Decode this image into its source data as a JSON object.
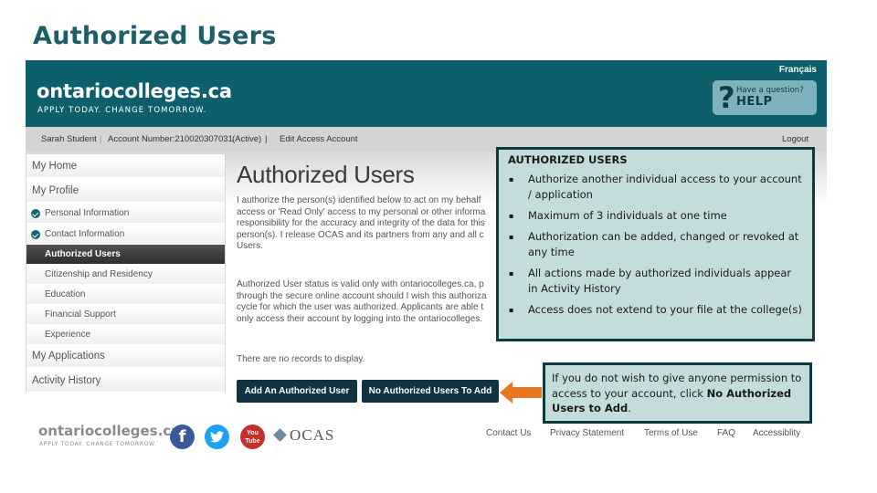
{
  "slide": {
    "title": "Authorized Users"
  },
  "header": {
    "logo_main": "ontariocolleges.ca",
    "logo_tagline": "APPLY TODAY. CHANGE TOMORROW.",
    "language_link": "Français",
    "help": {
      "icon": "question-mark",
      "small": "Have a question?",
      "big": "HELP"
    }
  },
  "account_bar": {
    "user_name": "Sarah Student",
    "account_label": "Account Number:210020307031",
    "status": "(Active)",
    "edit_link": "Edit Access Account",
    "logout": "Logout"
  },
  "sidebar": {
    "items": [
      {
        "label": "My Home",
        "type": "main"
      },
      {
        "label": "My Profile",
        "type": "main"
      },
      {
        "label": "Personal Information",
        "type": "sub",
        "completed": true
      },
      {
        "label": "Contact Information",
        "type": "sub",
        "completed": true
      },
      {
        "label": "Authorized Users",
        "type": "sub",
        "active": true
      },
      {
        "label": "Citizenship and Residency",
        "type": "sub"
      },
      {
        "label": "Education",
        "type": "sub"
      },
      {
        "label": "Financial Support",
        "type": "sub"
      },
      {
        "label": "Experience",
        "type": "sub"
      },
      {
        "label": "My Applications",
        "type": "main"
      },
      {
        "label": "Activity History",
        "type": "main"
      }
    ]
  },
  "main": {
    "heading": "Authorized Users",
    "paragraph1": [
      "I authorize the person(s) identified below to act on my behalf",
      "access or 'Read Only' access to my personal or other informa",
      "responsibility for the accuracy and integrity of the data for this",
      "person(s). I release OCAS and its partners from any and all c",
      "Users."
    ],
    "paragraph2": [
      "Authorized User status is valid only with ontariocolleges.ca, p",
      "through the secure online account should I wish this authoriza",
      "cycle for which the user was authorized. Applicants are able t",
      "only access their account by logging into the ontariocolleges."
    ],
    "empty_message": "There are no records to display.",
    "buttons": {
      "add": "Add An Authorized User",
      "none": "No Authorized Users To Add"
    }
  },
  "footer": {
    "logo_main": "ontariocolleges.ca",
    "logo_tagline": "APPLY TODAY. CHANGE TOMORROW.",
    "social": {
      "facebook": "f",
      "twitter": "🐦",
      "youtube_top": "You",
      "youtube_bottom": "Tube"
    },
    "ocas": "OCAS",
    "links": [
      "Contact Us",
      "Privacy Statement",
      "Terms of Use",
      "FAQ",
      "Accessiblity"
    ]
  },
  "callouts": {
    "main": {
      "title": "AUTHORIZED USERS",
      "bullets": [
        "Authorize another individual access to your account / application",
        "Maximum of 3 individuals at one time",
        "Authorization can be added, changed or revoked at any time",
        "All actions made by authorized individuals appear in Activity History",
        "Access does not extend to your file at the college(s)"
      ]
    },
    "tip": {
      "text": "If you do not wish to give anyone permission to access to your account, click ",
      "bold": "No Authorized Users to Add",
      "end": "."
    }
  },
  "colors": {
    "header_teal": "#0d5f6c",
    "button_dark": "#0f3340",
    "callout_bg": "#c5dcdc",
    "callout_border": "#0d3a42",
    "arrow_orange": "#e87722",
    "title_teal": "#1d5e6a"
  }
}
